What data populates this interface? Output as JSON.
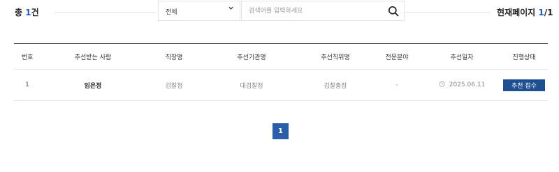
{
  "summary": {
    "total_prefix": "총 ",
    "total_count": "1",
    "total_suffix": "건"
  },
  "filter": {
    "selected": "전체"
  },
  "search": {
    "placeholder": "검색어를 입력하세요",
    "value": ""
  },
  "page_info": {
    "label": "현재페이지 ",
    "current": "1",
    "separator": "/",
    "total": "1"
  },
  "table": {
    "headers": [
      "번호",
      "추선받는 사람",
      "직장명",
      "추선기관명",
      "추선직위명",
      "전문분야",
      "추선일자",
      "진행상태"
    ],
    "rows": [
      {
        "number": "1",
        "nominee": "임은정",
        "workplace": "검찰청",
        "org": "대검찰청",
        "position": "검찰총장",
        "field": "-",
        "date": "2025.06.11",
        "status": "추천 접수"
      }
    ]
  },
  "pagination": {
    "pages": [
      "1"
    ],
    "current": "1"
  },
  "colors": {
    "accent": "#1e5bb8",
    "badge": "#1d4f91",
    "pager": "#2a5ea8"
  },
  "icons": {
    "filter_chevron": "chevron-down-icon",
    "search_button": "search-icon",
    "date": "clock-icon"
  }
}
